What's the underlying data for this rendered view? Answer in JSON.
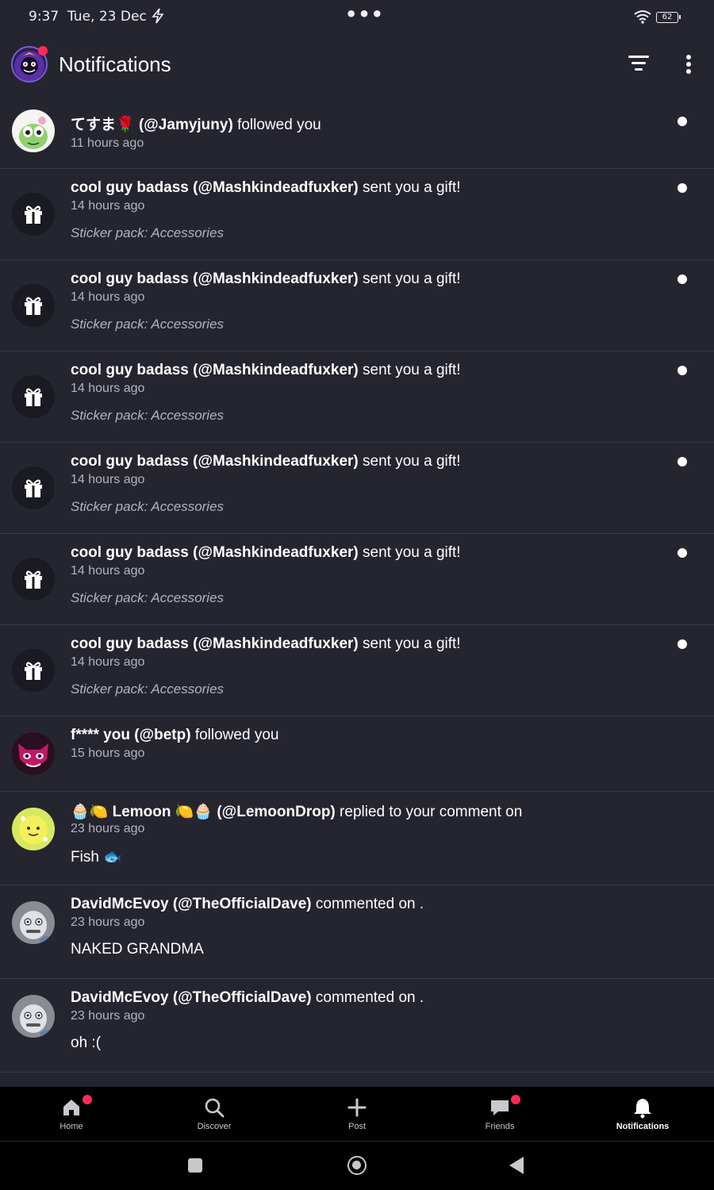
{
  "status_bar": {
    "time": "9:37",
    "date": "Tue, 23 Dec",
    "battery": "62"
  },
  "header": {
    "title": "Notifications"
  },
  "notifications": [
    {
      "name": "てすま🌹",
      "handle": "(@Jamyjuny)",
      "action": " followed you",
      "time": "11 hours ago",
      "sub": "",
      "body": "",
      "unread": true,
      "avatar": "green-alien"
    },
    {
      "name": "cool guy badass",
      "handle": "(@Mashkindeadfuxker)",
      "action": " sent you a gift!",
      "time": "14 hours ago",
      "sub": "Sticker pack: Accessories",
      "body": "",
      "unread": true,
      "avatar": "gift-icon"
    },
    {
      "name": "cool guy badass",
      "handle": "(@Mashkindeadfuxker)",
      "action": " sent you a gift!",
      "time": "14 hours ago",
      "sub": "Sticker pack: Accessories",
      "body": "",
      "unread": true,
      "avatar": "gift-icon"
    },
    {
      "name": "cool guy badass",
      "handle": "(@Mashkindeadfuxker)",
      "action": " sent you a gift!",
      "time": "14 hours ago",
      "sub": "Sticker pack: Accessories",
      "body": "",
      "unread": true,
      "avatar": "gift-icon"
    },
    {
      "name": "cool guy badass",
      "handle": "(@Mashkindeadfuxker)",
      "action": " sent you a gift!",
      "time": "14 hours ago",
      "sub": "Sticker pack: Accessories",
      "body": "",
      "unread": true,
      "avatar": "gift-icon"
    },
    {
      "name": "cool guy badass",
      "handle": "(@Mashkindeadfuxker)",
      "action": " sent you a gift!",
      "time": "14 hours ago",
      "sub": "Sticker pack: Accessories",
      "body": "",
      "unread": true,
      "avatar": "gift-icon"
    },
    {
      "name": "cool guy badass",
      "handle": "(@Mashkindeadfuxker)",
      "action": " sent you a gift!",
      "time": "14 hours ago",
      "sub": "Sticker pack: Accessories",
      "body": "",
      "unread": true,
      "avatar": "gift-icon"
    },
    {
      "name": "f**** you",
      "handle": "(@betp)",
      "action": " followed you",
      "time": "15 hours ago",
      "sub": "",
      "body": "",
      "unread": false,
      "avatar": "pink-cat"
    },
    {
      "name": "🧁🍋 Lemoon 🍋🧁",
      "handle": "(@LemoonDrop)",
      "action": " replied to your comment on",
      "time": "23 hours ago",
      "sub": "",
      "body": "Fish 🐟",
      "unread": false,
      "avatar": "yellow-lemon"
    },
    {
      "name": "DavidMcEvoy",
      "handle": "(@TheOfficialDave)",
      "action": " commented on .",
      "time": "23 hours ago",
      "sub": "",
      "body": "NAKED GRANDMA",
      "unread": false,
      "avatar": "grey-face"
    },
    {
      "name": "DavidMcEvoy",
      "handle": "(@TheOfficialDave)",
      "action": " commented on .",
      "time": "23 hours ago",
      "sub": "",
      "body": "oh :(",
      "unread": false,
      "avatar": "grey-face"
    }
  ],
  "bottom_nav": [
    {
      "label": "Home",
      "icon": "home-icon",
      "badge": true,
      "active": false
    },
    {
      "label": "Discover",
      "icon": "search-icon",
      "badge": false,
      "active": false
    },
    {
      "label": "Post",
      "icon": "plus-icon",
      "badge": false,
      "active": false
    },
    {
      "label": "Friends",
      "icon": "chat-icon",
      "badge": true,
      "active": false
    },
    {
      "label": "Notifications",
      "icon": "bell-icon",
      "badge": false,
      "active": true
    }
  ],
  "colors": {
    "background": "#252530",
    "divider": "#3a3a46",
    "badge": "#ff2d55",
    "nav_background": "#000000"
  }
}
